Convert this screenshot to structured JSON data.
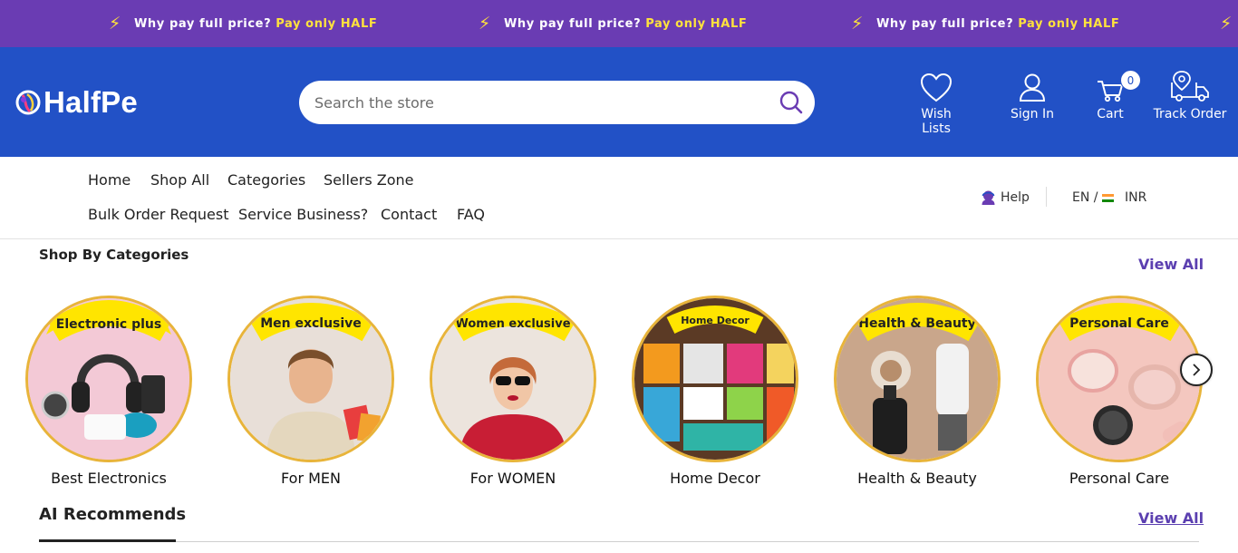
{
  "promo": {
    "text": "Why pay full price?",
    "highlight": "Pay only HALF",
    "accent_color": "#ffe23d",
    "background": "#6a3cb3"
  },
  "header": {
    "logo_text": "HalfPe",
    "background": "#2251c6",
    "search": {
      "placeholder": "Search the store"
    },
    "actions": {
      "wishlist": "Wish Lists",
      "signin": "Sign In",
      "cart": "Cart",
      "cart_count": "0",
      "track": "Track Order"
    }
  },
  "nav": {
    "links": [
      "Home",
      "Shop All",
      "Categories",
      "Sellers Zone",
      "Bulk Order Request",
      "Service Business?",
      "Contact",
      "FAQ"
    ],
    "help": "Help",
    "language": "EN /",
    "currency": "INR"
  },
  "categories": {
    "title": "Shop By Categories",
    "view_all": "View All",
    "items": [
      {
        "badge": "Electronic plus",
        "label": "Best Electronics"
      },
      {
        "badge": "Men exclusive",
        "label": "For MEN"
      },
      {
        "badge": "Women exclusive",
        "label": "For WOMEN"
      },
      {
        "badge": "Home Decor",
        "label": "Home Decor"
      },
      {
        "badge": "Health & Beauty",
        "label": "Health & Beauty"
      },
      {
        "badge": "Personal Care",
        "label": "Personal Care"
      }
    ]
  },
  "ai": {
    "title": "AI Recommends",
    "view_all": "View All"
  }
}
